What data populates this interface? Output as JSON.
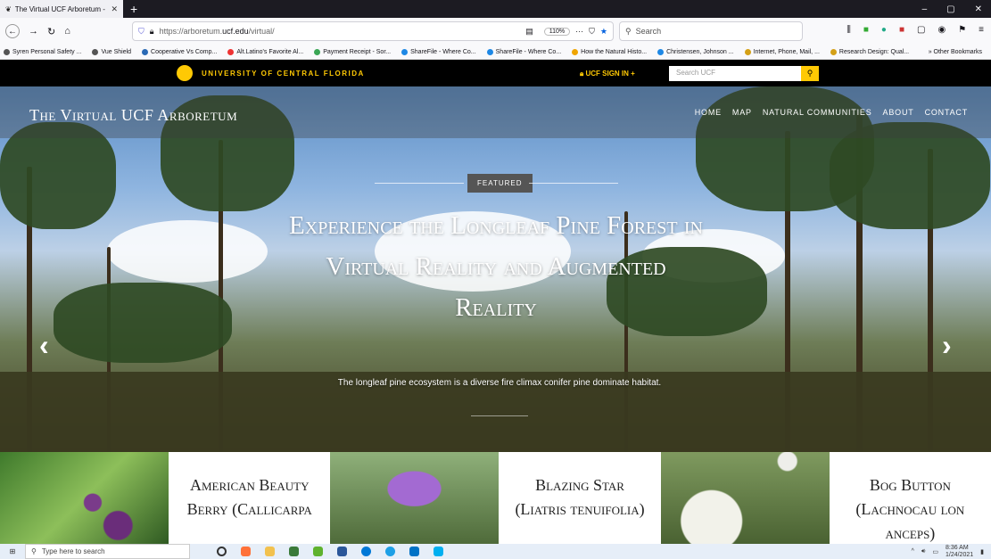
{
  "browser": {
    "tab_title": "The Virtual UCF Arboretum - V",
    "tab_close": "✕",
    "new_tab": "+",
    "window_controls": [
      "–",
      "▢",
      "✕"
    ],
    "url_host_prefix": "https://arboretum.",
    "url_host_main": "ucf.edu",
    "url_path": "/virtual/",
    "zoom": "110%",
    "search_placeholder": "Search",
    "bookmarks": [
      {
        "label": "Syren Personal Safety ...",
        "color": "#555555"
      },
      {
        "label": "Vue Shield",
        "color": "#555555"
      },
      {
        "label": "Cooperative Vs Comp...",
        "color": "#2b6ab5"
      },
      {
        "label": "Alt.Latino's Favorite Al...",
        "color": "#e33"
      },
      {
        "label": "Payment Receipt - Sor...",
        "color": "#3aa655"
      },
      {
        "label": "ShareFile - Where Co...",
        "color": "#1e88e5"
      },
      {
        "label": "ShareFile - Where Co...",
        "color": "#1e88e5"
      },
      {
        "label": "How the Natural Histo...",
        "color": "#f0a500"
      },
      {
        "label": "Christensen, Johnson ...",
        "color": "#1e88e5"
      },
      {
        "label": "Internet, Phone, Mail, ...",
        "color": "#d4a017"
      },
      {
        "label": "Research Design: Qual...",
        "color": "#d4a017"
      }
    ],
    "other_bookmarks": "Other Bookmarks"
  },
  "ucf_bar": {
    "name": "UNIVERSITY OF CENTRAL FLORIDA",
    "sign_in": "UCF SIGN IN",
    "search_placeholder": "Search UCF",
    "brand_color": "#ffc904"
  },
  "site": {
    "title": "The Virtual UCF Arboretum",
    "nav": [
      "HOME",
      "MAP",
      "NATURAL COMMUNITIES",
      "ABOUT",
      "CONTACT"
    ]
  },
  "hero": {
    "badge": "FEATURED",
    "headline": "Experience the Longleaf Pine Forest in Virtual Reality and Augmented Reality",
    "subtitle": "The longleaf pine ecosystem is a diverse fire climax conifer pine dominate habitat.",
    "prev": "‹",
    "next": "›"
  },
  "cards": [
    {
      "title": "American Beauty Berry (Callicarpa"
    },
    {
      "title": "Blazing Star (Liatris tenuifolia)"
    },
    {
      "title": "Bog Button (Lachnocau lon anceps)"
    }
  ],
  "taskbar": {
    "search_placeholder": "Type here to search",
    "time": "8:36 AM",
    "date": "1/24/2021"
  }
}
